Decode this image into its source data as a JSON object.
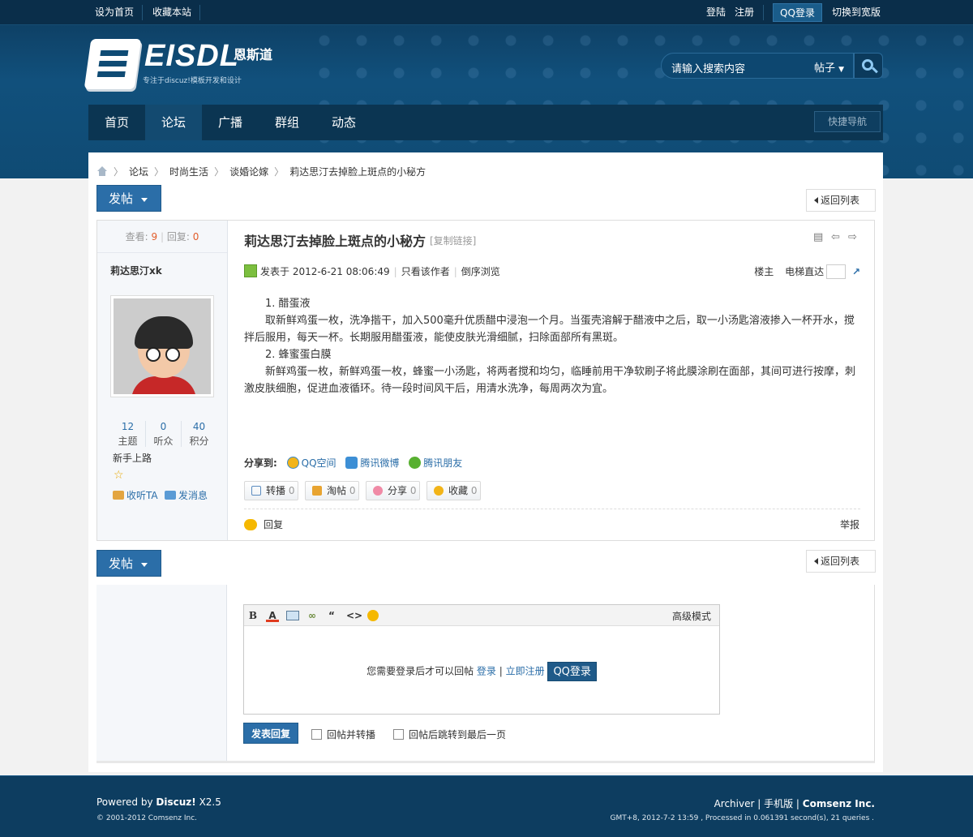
{
  "topbar": {
    "set_home": "设为首页",
    "bookmark": "收藏本站",
    "login": "登陆",
    "register": "注册",
    "qq_login": "QQ登录",
    "switch_wide": "切换到宽版"
  },
  "logo": {
    "name": "EISDL",
    "cn": "恩斯道",
    "tagline": "专注于discuz!模板开发和设计"
  },
  "search": {
    "placeholder": "请输入搜索内容",
    "type": "帖子"
  },
  "nav": {
    "items": [
      "首页",
      "论坛",
      "广播",
      "群组",
      "动态"
    ],
    "active_index": 1,
    "quick_nav": "快捷导航"
  },
  "breadcrumb": [
    "论坛",
    "时尚生活",
    "谈婚论嫁",
    "莉达思汀去掉脸上斑点的小秘方"
  ],
  "buttons": {
    "new_post": "发帖",
    "back_to_list": "返回列表"
  },
  "post": {
    "views_label": "查看:",
    "views": "9",
    "replies_label": "回复:",
    "replies": "0",
    "author": "莉达思汀xk",
    "user_stats": [
      {
        "value": "12",
        "label": "主题"
      },
      {
        "value": "0",
        "label": "听众"
      },
      {
        "value": "40",
        "label": "积分"
      }
    ],
    "rank": "新手上路",
    "follow": "收听TA",
    "send_msg": "发消息",
    "title": "莉达思汀去掉脸上斑点的小秘方",
    "copy_link": "[复制链接]",
    "posted_at": "发表于 2012-6-21 08:06:49",
    "only_author": "只看该作者",
    "reverse": "倒序浏览",
    "floor_owner": "楼主",
    "floor_jump": "电梯直达",
    "content": [
      "1. 醋蛋液",
      "取新鲜鸡蛋一枚，洗净揩干，加入500毫升优质醋中浸泡一个月。当蛋壳溶解于醋液中之后，取一小汤匙溶液掺入一杯开水，搅拌后服用，每天一杯。长期服用醋蛋液，能使皮肤光滑细腻，扫除面部所有黑斑。",
      "2. 蜂蜜蛋白膜",
      "新鲜鸡蛋一枚，新鲜鸡蛋一枚，蜂蜜一小汤匙，将两者搅和均匀，临睡前用干净软刷子将此膜涂刷在面部，其间可进行按摩，刺激皮肤细胞，促进血液循环。待一段时间风干后，用清水洗净，每周两次为宜。"
    ],
    "share_label": "分享到:",
    "share": [
      "QQ空间",
      "腾讯微博",
      "腾讯朋友"
    ],
    "actions": [
      {
        "label": "转播",
        "count": "0"
      },
      {
        "label": "淘帖",
        "count": "0"
      },
      {
        "label": "分享",
        "count": "0"
      },
      {
        "label": "收藏",
        "count": "0"
      }
    ],
    "reply": "回复",
    "report": "举报"
  },
  "reply_box": {
    "advanced_mode": "高级模式",
    "login_tip": "您需要登录后才可以回帖",
    "login": "登录",
    "register_now": "立即注册",
    "qq_login": "QQ登录",
    "submit": "发表回复",
    "repost": "回帖并转播",
    "jump_last": "回帖后跳转到最后一页"
  },
  "footer": {
    "powered_by": "Powered by",
    "discuz": "Discuz!",
    "version": "X2.5",
    "copyright": "© 2001-2012 Comsenz Inc.",
    "archiver": "Archiver",
    "mobile": "手机版",
    "comsenz": "Comsenz Inc.",
    "gmt": "GMT+8, 2012-7-2 13:59 , Processed in 0.061391 second(s), 21 queries ."
  },
  "colors": {
    "header_dark": "#0d3a5c",
    "accent_blue": "#2b6ea8",
    "counter_red": "#e25c2a"
  }
}
